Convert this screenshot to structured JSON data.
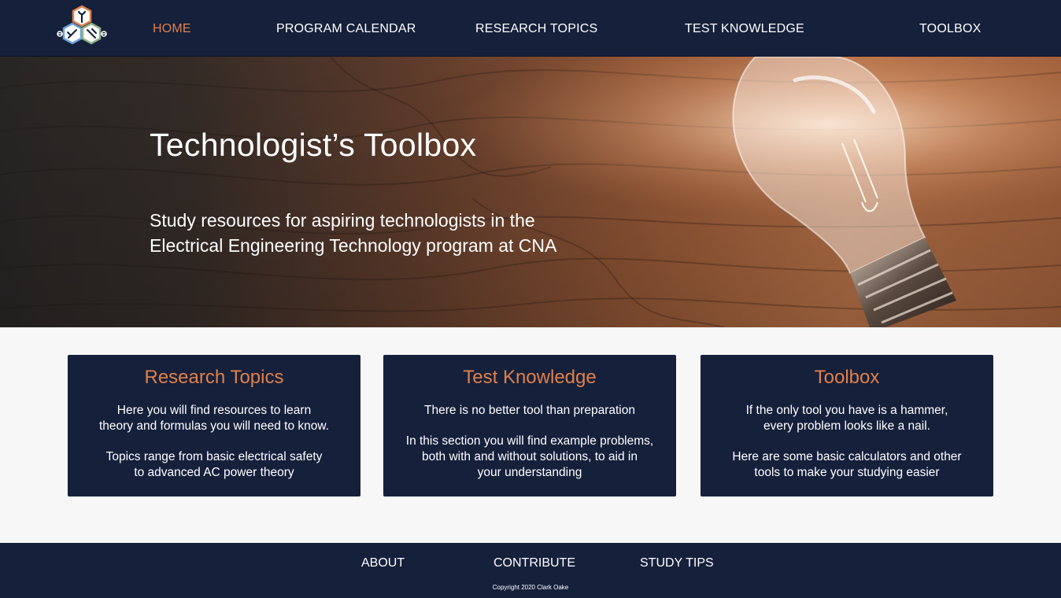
{
  "header": {
    "logo": "hexagon-tools-logo",
    "nav": [
      {
        "label": "HOME",
        "active": true
      },
      {
        "label": "PROGRAM CALENDAR",
        "active": false
      },
      {
        "label": "RESEARCH TOPICS",
        "active": false
      },
      {
        "label": "TEST KNOWLEDGE",
        "active": false
      },
      {
        "label": "TOOLBOX",
        "active": false
      }
    ]
  },
  "hero": {
    "title": "Technologist’s Toolbox",
    "subtitle_line1": "Study resources for aspiring technologists in the",
    "subtitle_line2": "Electrical Engineering Technology program at CNA",
    "image": "light-bulb-on-wood"
  },
  "cards": [
    {
      "title": "Research Topics",
      "p1_line1": "Here you will find resources to learn",
      "p1_line2": "theory and formulas you will need to know.",
      "p2_line1": "Topics range from basic electrical safety",
      "p2_line2": "to advanced AC power theory"
    },
    {
      "title": "Test Knowledge",
      "p1_line1": "There is no better tool than preparation",
      "p2_line1": "In this section you will find example problems,",
      "p2_line2": "both with and without solutions, to aid in",
      "p2_line3": "your understanding"
    },
    {
      "title": "Toolbox",
      "p1_line1": "If the only tool you have is a hammer,",
      "p1_line2": "every problem looks like a nail.",
      "p2_line1": "Here are some basic calculators and other",
      "p2_line2": "tools to make your studying easier"
    }
  ],
  "footer": {
    "links": [
      "ABOUT",
      "CONTRIBUTE",
      "STUDY TIPS"
    ],
    "copyright": "Copyright 2020 Clark Oake"
  },
  "colors": {
    "navy": "#15203b",
    "accent": "#e0804a",
    "page_bg": "#f7f7f7"
  }
}
